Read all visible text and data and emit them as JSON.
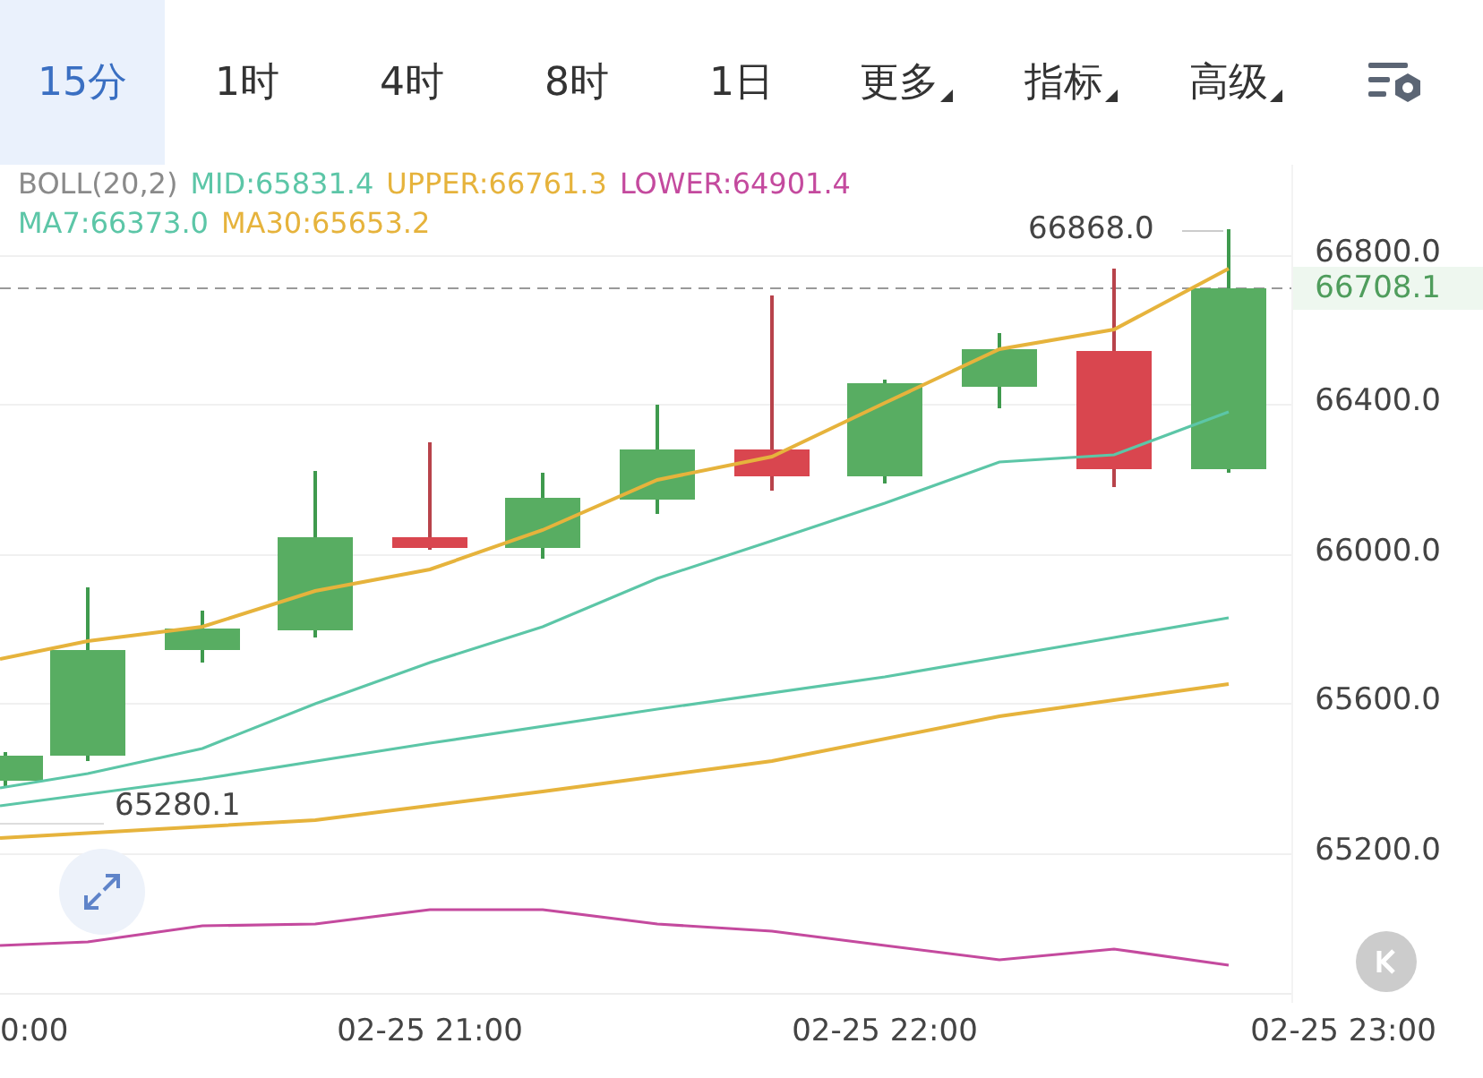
{
  "tabs": [
    {
      "label": "15分",
      "selected": true,
      "kind": "period"
    },
    {
      "label": "1时",
      "selected": false,
      "kind": "period"
    },
    {
      "label": "4时",
      "selected": false,
      "kind": "period"
    },
    {
      "label": "8时",
      "selected": false,
      "kind": "period"
    },
    {
      "label": "1日",
      "selected": false,
      "kind": "period"
    },
    {
      "label": "更多",
      "selected": false,
      "kind": "dropdown"
    },
    {
      "label": "指标",
      "selected": false,
      "kind": "dropdown"
    },
    {
      "label": "高级",
      "selected": false,
      "kind": "dropdown"
    }
  ],
  "legend": [
    [
      {
        "text": "BOLL(20,2)",
        "color": "#8a8a8a"
      },
      {
        "text": "MID:65831.4",
        "color": "#5cc6a7"
      },
      {
        "text": "UPPER:66761.3",
        "color": "#e6b33c"
      },
      {
        "text": "LOWER:64901.4",
        "color": "#c44a9e"
      }
    ],
    [
      {
        "text": "MA7:66373.0",
        "color": "#5cc6a7"
      },
      {
        "text": "MA30:65653.2",
        "color": "#e6b33c"
      }
    ]
  ],
  "y_axis": [
    "66800.0",
    "66400.0",
    "66000.0",
    "65600.0",
    "65200.0"
  ],
  "current_price": "66708.1",
  "high_label": "66868.0",
  "low_label": "65280.1",
  "x_axis": [
    "0:00",
    "02-25 21:00",
    "02-25 22:00",
    "02-25 23:00"
  ]
}
